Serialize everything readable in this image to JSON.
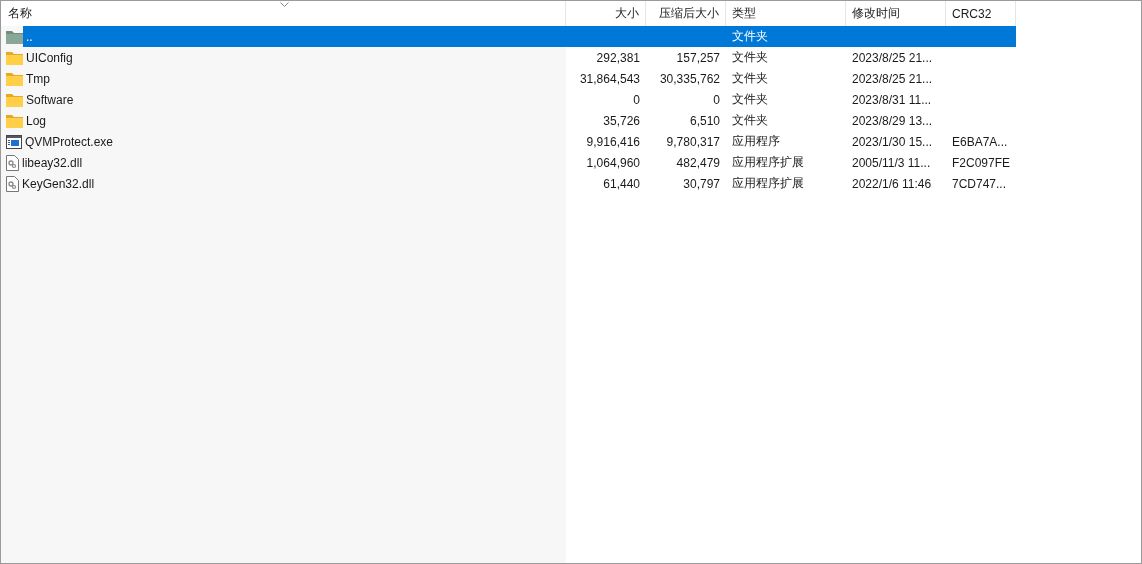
{
  "table": {
    "columns": [
      {
        "label": "名称",
        "sorted": true
      },
      {
        "label": "大小",
        "sorted": false
      },
      {
        "label": "压缩后大小",
        "sorted": false
      },
      {
        "label": "类型",
        "sorted": false
      },
      {
        "label": "修改时间",
        "sorted": false
      },
      {
        "label": "CRC32",
        "sorted": false
      }
    ],
    "rows": [
      {
        "kind": "parent",
        "name": "..",
        "type": "文件夹",
        "selected": true
      },
      {
        "kind": "folder",
        "name": "UIConfig",
        "size": "292,381",
        "packed": "157,257",
        "type": "文件夹",
        "modified": "2023/8/25 21...",
        "selected": false
      },
      {
        "kind": "folder",
        "name": "Tmp",
        "size": "31,864,543",
        "packed": "30,335,762",
        "type": "文件夹",
        "modified": "2023/8/25 21...",
        "selected": false
      },
      {
        "kind": "folder",
        "name": "Software",
        "size": "0",
        "packed": "0",
        "type": "文件夹",
        "modified": "2023/8/31 11...",
        "selected": false
      },
      {
        "kind": "folder",
        "name": "Log",
        "size": "35,726",
        "packed": "6,510",
        "type": "文件夹",
        "modified": "2023/8/29 13...",
        "selected": false
      },
      {
        "kind": "exe",
        "name": "QVMProtect.exe",
        "size": "9,916,416",
        "packed": "9,780,317",
        "type": "应用程序",
        "modified": "2023/1/30 15...",
        "crc": "E6BA7A...",
        "selected": false
      },
      {
        "kind": "dll",
        "name": "libeay32.dll",
        "size": "1,064,960",
        "packed": "482,479",
        "type": "应用程序扩展",
        "modified": "2005/11/3 11...",
        "crc": "F2C097FE",
        "selected": false
      },
      {
        "kind": "dll",
        "name": "KeyGen32.dll",
        "size": "61,440",
        "packed": "30,797",
        "type": "应用程序扩展",
        "modified": "2022/1/6 11:46",
        "crc": "7CD747...",
        "selected": false
      }
    ]
  }
}
